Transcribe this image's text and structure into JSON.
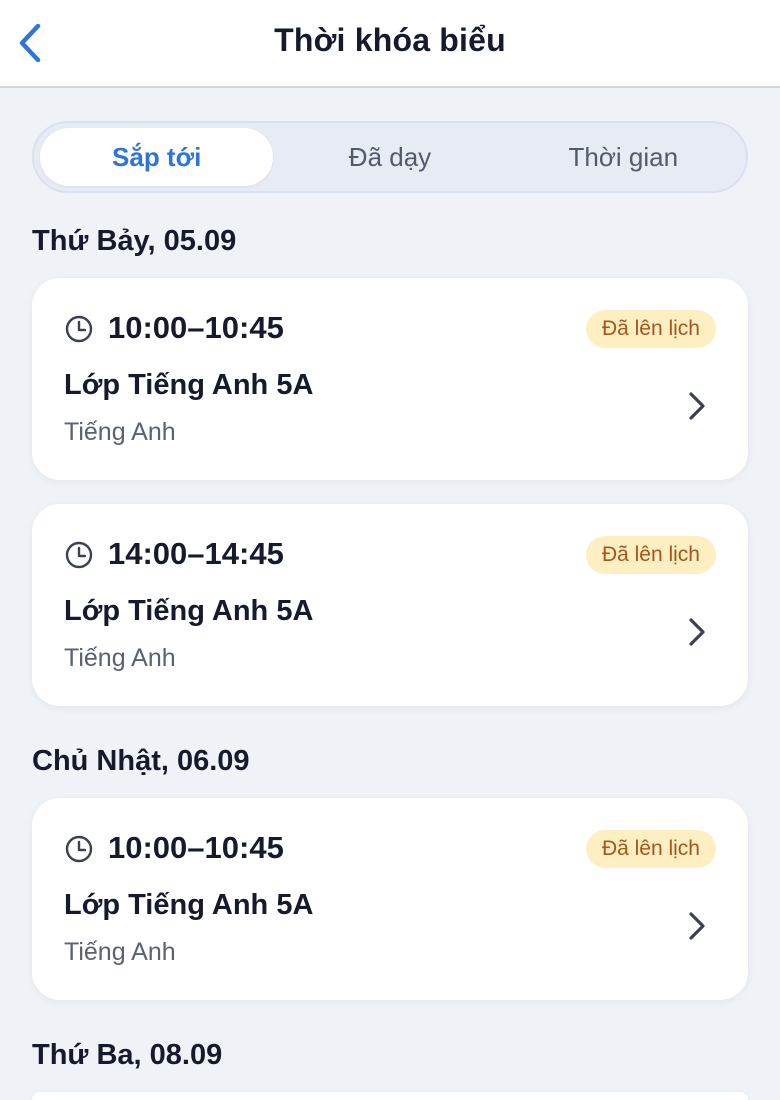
{
  "header": {
    "title": "Thời khóa biểu"
  },
  "tabs": [
    {
      "label": "Sắp tới",
      "active": true
    },
    {
      "label": "Đã dạy",
      "active": false
    },
    {
      "label": "Thời gian",
      "active": false
    }
  ],
  "days": [
    {
      "heading": "Thứ Bảy, 05.09",
      "lessons": [
        {
          "time": "10:00–10:45",
          "status": "Đã lên lịch",
          "class_name": "Lớp Tiếng Anh 5A",
          "subject": "Tiếng Anh"
        },
        {
          "time": "14:00–14:45",
          "status": "Đã lên lịch",
          "class_name": "Lớp Tiếng Anh 5A",
          "subject": "Tiếng Anh"
        }
      ]
    },
    {
      "heading": "Chủ Nhật, 06.09",
      "lessons": [
        {
          "time": "10:00–10:45",
          "status": "Đã lên lịch",
          "class_name": "Lớp Tiếng Anh 5A",
          "subject": "Tiếng Anh"
        }
      ]
    },
    {
      "heading": "Thứ Ba, 08.09",
      "lessons": []
    }
  ],
  "colors": {
    "accent": "#2f74d8",
    "badge_bg": "#fdefc2",
    "badge_text": "#a9541a",
    "background": "#eff2f7"
  },
  "icons": {
    "back": "chevron-left-icon",
    "time": "clock-icon",
    "open": "chevron-right-icon"
  }
}
